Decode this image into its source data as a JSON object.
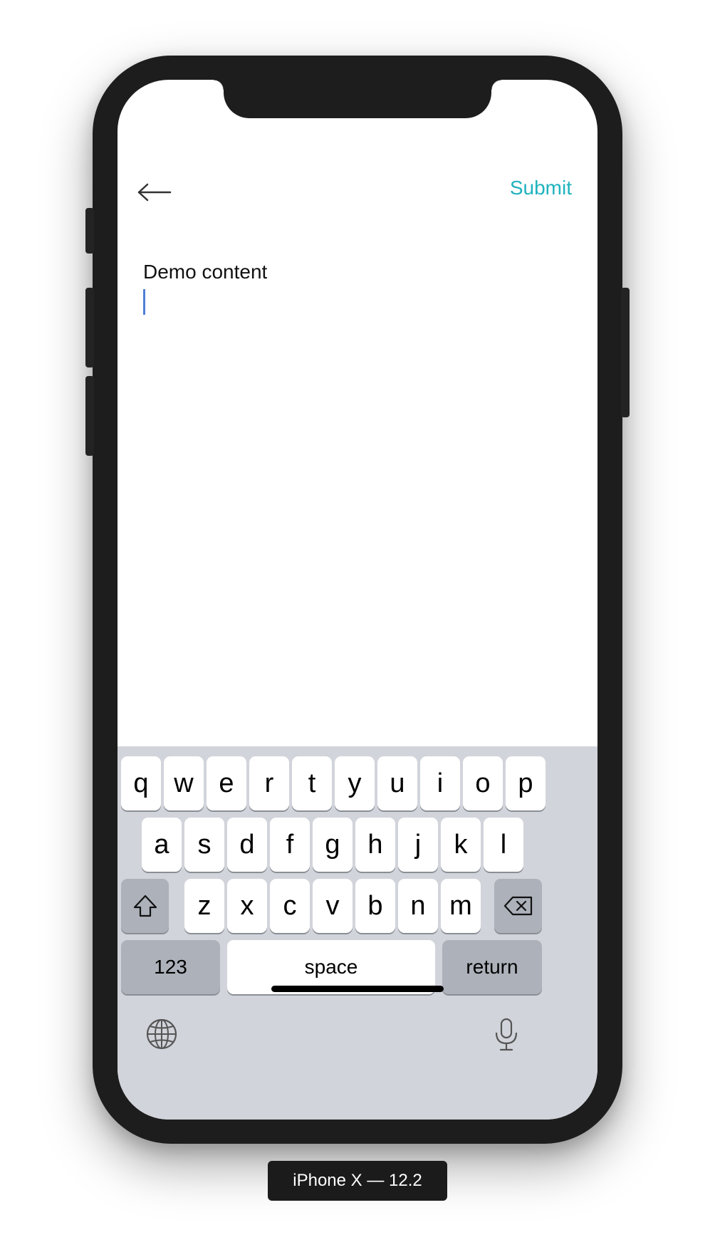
{
  "nav": {
    "back_icon": "arrow-left-icon",
    "submit_label": "Submit",
    "accent_color": "#1fb3bd"
  },
  "editor": {
    "content": "Demo content",
    "caret_color": "#4f7fd6"
  },
  "keyboard": {
    "row1": [
      "q",
      "w",
      "e",
      "r",
      "t",
      "y",
      "u",
      "i",
      "o",
      "p"
    ],
    "row2": [
      "a",
      "s",
      "d",
      "f",
      "g",
      "h",
      "j",
      "k",
      "l"
    ],
    "row3": [
      "z",
      "x",
      "c",
      "v",
      "b",
      "n",
      "m"
    ],
    "shift_icon": "shift-icon",
    "delete_icon": "backspace-icon",
    "numbers_label": "123",
    "space_label": "space",
    "return_label": "return",
    "globe_icon": "globe-icon",
    "mic_icon": "microphone-icon"
  },
  "device": {
    "label": "iPhone X — 12.2"
  }
}
